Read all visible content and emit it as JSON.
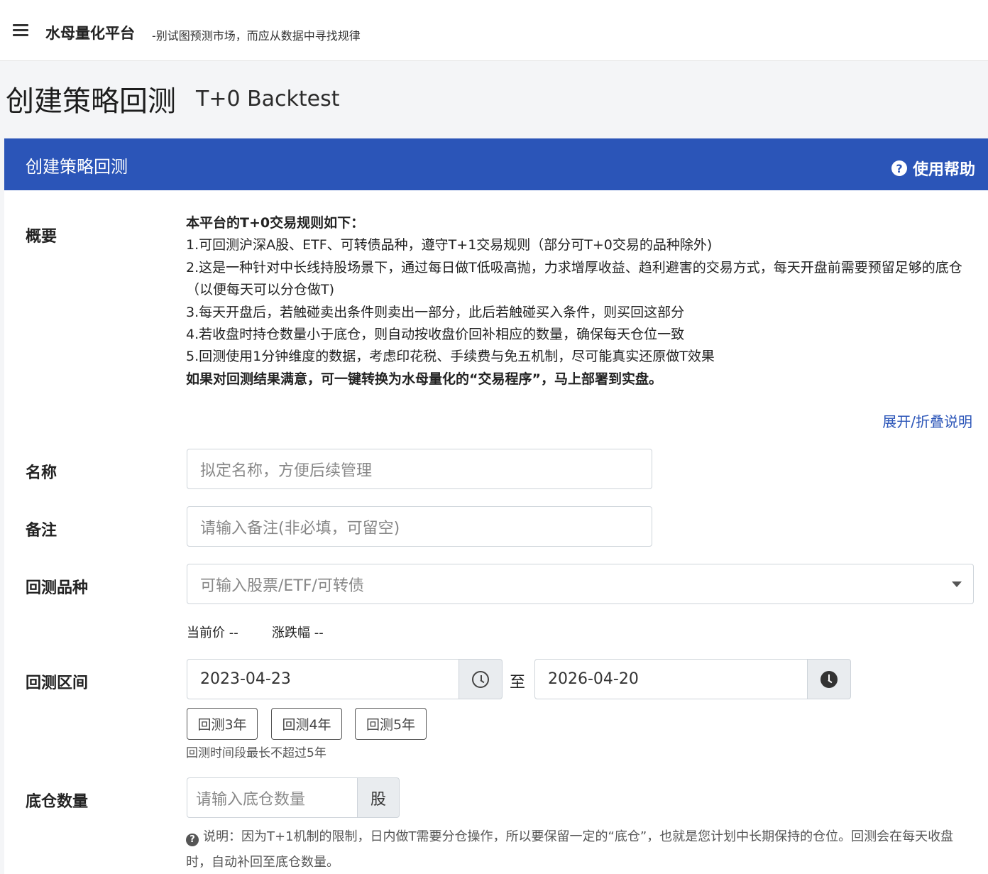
{
  "topbar": {
    "brand": "水母量化平台",
    "tagline": "-别试图预测市场，而应从数据中寻找规律"
  },
  "page": {
    "title": "创建策略回测",
    "subtitle": "T+0 Backtest"
  },
  "card": {
    "title": "创建策略回测",
    "help_label": "使用帮助"
  },
  "overview": {
    "label": "概要",
    "heading": "本平台的T+0交易规则如下：",
    "items": [
      "1.可回测沪深A股、ETF、可转债品种，遵守T+1交易规则（部分可T+0交易的品种除外)",
      "2.这是一种针对中长线持股场景下，通过每日做T低吸高抛，力求增厚收益、趋利避害的交易方式，每天开盘前需要预留足够的底仓（以便每天可以分仓做T)",
      "3.每天开盘后，若触碰卖出条件则卖出一部分，此后若触碰买入条件，则买回这部分",
      "4.若收盘时持仓数量小于底仓，则自动按收盘价回补相应的数量，确保每天仓位一致",
      "5.回测使用1分钟维度的数据，考虑印花税、手续费与免五机制，尽可能真实还原做T效果"
    ],
    "footer": "如果对回测结果满意，可一键转换为水母量化的“交易程序”，马上部署到实盘。",
    "toggle_label": "展开/折叠说明"
  },
  "form": {
    "name": {
      "label": "名称",
      "placeholder": "拟定名称，方便后续管理"
    },
    "remark": {
      "label": "备注",
      "placeholder": "请输入备注(非必填，可留空)"
    },
    "symbol": {
      "label": "回测品种",
      "placeholder": "可输入股票/ETF/可转债",
      "current_price": "当前价 --",
      "change": "涨跌幅 --"
    },
    "range": {
      "label": "回测区间",
      "start": "2023-04-23",
      "to": "至",
      "end": "2026-04-20",
      "quick": [
        "回测3年",
        "回测4年",
        "回测5年"
      ],
      "hint": "回测时间段最长不超过5年"
    },
    "base": {
      "label": "底仓数量",
      "placeholder": "请输入底仓数量",
      "unit": "股",
      "note": "说明：因为T+1机制的限制，日内做T需要分仓操作，所以要保留一定的“底仓”，也就是您计划中长期保持的仓位。回测会在每天收盘时，自动补回至底仓数量。"
    }
  },
  "colors": {
    "header_blue": "#2b55b8",
    "link_blue": "#2b55b8",
    "background": "#f4f5f7"
  }
}
